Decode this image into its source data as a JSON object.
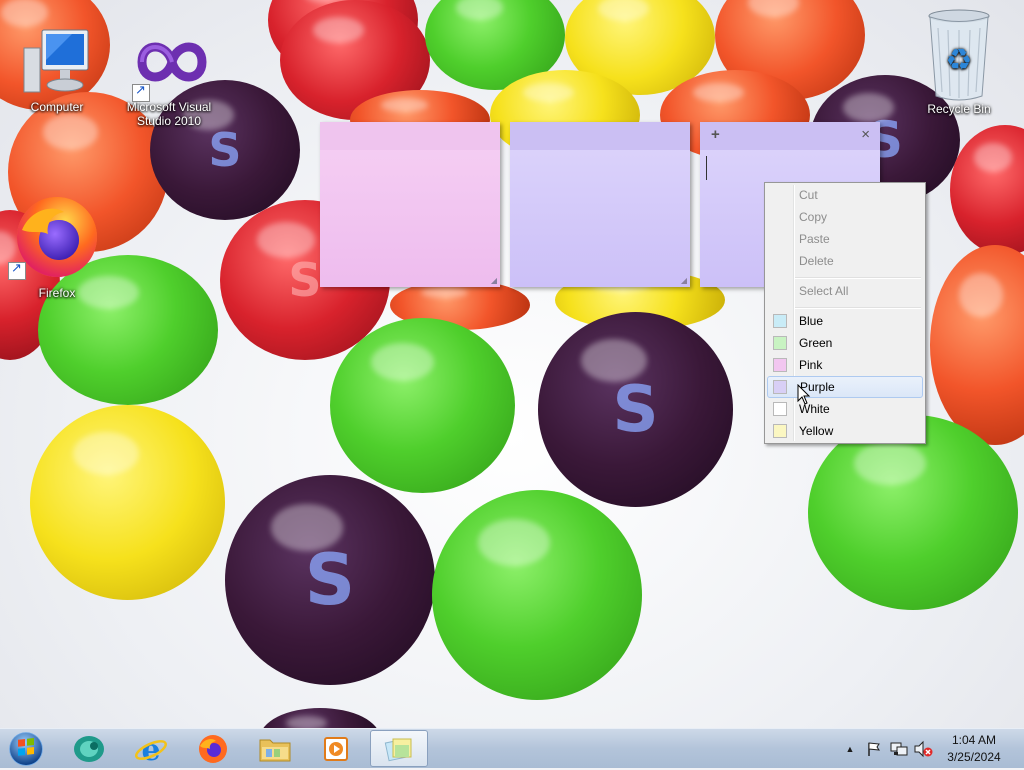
{
  "desktop": {
    "icons": [
      {
        "label": "Computer",
        "icon": "computer-icon"
      },
      {
        "label": "Microsoft Visual Studio 2010",
        "icon": "visual-studio-icon"
      },
      {
        "label": "Firefox",
        "icon": "firefox-icon"
      },
      {
        "label": "Recycle Bin",
        "icon": "recycle-bin-icon"
      }
    ]
  },
  "notes": [
    {
      "color": "Pink",
      "text": ""
    },
    {
      "color": "Purple",
      "text": ""
    },
    {
      "color": "Purple",
      "text": "",
      "active": true,
      "add_label": "+",
      "close_label": "×"
    }
  ],
  "context_menu": {
    "items": [
      {
        "label": "Cut",
        "enabled": false
      },
      {
        "label": "Copy",
        "enabled": false
      },
      {
        "label": "Paste",
        "enabled": false
      },
      {
        "label": "Delete",
        "enabled": false
      },
      {
        "label": "Select All",
        "enabled": false
      }
    ],
    "colors": [
      {
        "label": "Blue",
        "swatch": "#c9ecf7"
      },
      {
        "label": "Green",
        "swatch": "#c8f3c2"
      },
      {
        "label": "Pink",
        "swatch": "#f2c6f0"
      },
      {
        "label": "Purple",
        "swatch": "#d8cff6",
        "highlighted": true
      },
      {
        "label": "White",
        "swatch": "#ffffff"
      },
      {
        "label": "Yellow",
        "swatch": "#fbf7c2"
      }
    ]
  },
  "taskbar": {
    "pinned": [
      "start-orb",
      "messenger-icon",
      "internet-explorer-icon",
      "firefox-icon",
      "file-explorer-icon",
      "media-player-icon",
      "sticky-notes-icon"
    ],
    "active": "sticky-notes-icon",
    "tray": {
      "show_hidden": "▲",
      "time": "1:04 AM",
      "date": "3/25/2024"
    }
  }
}
